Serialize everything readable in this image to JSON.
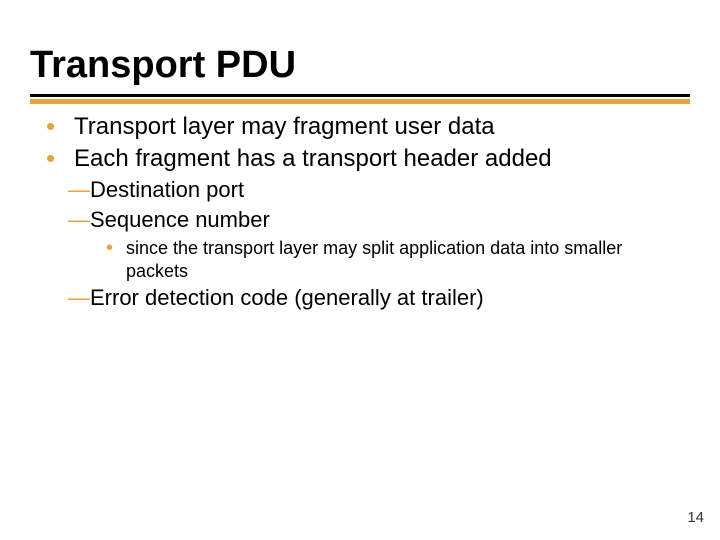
{
  "colors": {
    "accent": "#e8a33d",
    "text": "#000000"
  },
  "title": "Transport PDU",
  "bullets": {
    "b1": "Transport layer may fragment user data",
    "b2": "Each fragment has a transport header added",
    "s1": "Destination port",
    "s2": "Sequence number",
    "s2a": "since the transport layer may split application data into smaller packets",
    "s3": "Error detection code (generally at trailer)"
  },
  "page_number": "14"
}
